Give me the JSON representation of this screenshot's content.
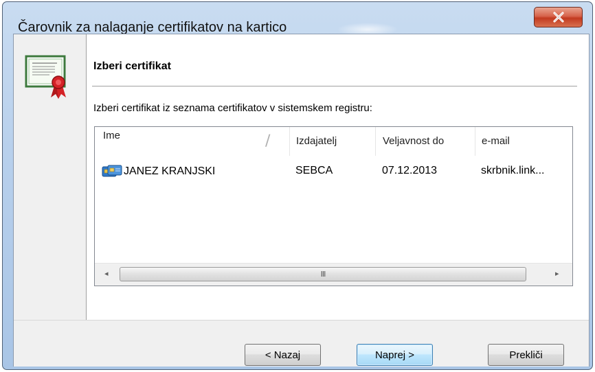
{
  "window": {
    "title": "Čarovnik za nalaganje certifikatov na kartico",
    "close_icon": "close-x-icon"
  },
  "page": {
    "icon": "certificate-icon",
    "heading": "Izberi certifikat",
    "instruction": "Izberi certifikat iz seznama certifikatov v sistemskem registru:"
  },
  "list": {
    "columns": [
      "Ime",
      "Izdajatelj",
      "Veljavnost do",
      "e-mail"
    ],
    "sort_glyph": "/",
    "rows": [
      {
        "icon": "smartcard-certificate-icon",
        "name": "JANEZ KRANJSKI",
        "issuer": "SEBCA",
        "valid_until": "07.12.2013",
        "email": "skrbnik.link..."
      }
    ],
    "scrollbar": {
      "left_arrow": "◂",
      "right_arrow": "▸",
      "grip": "III"
    }
  },
  "buttons": {
    "back": "< Nazaj",
    "next": "Naprej >",
    "cancel": "Prekliči"
  }
}
